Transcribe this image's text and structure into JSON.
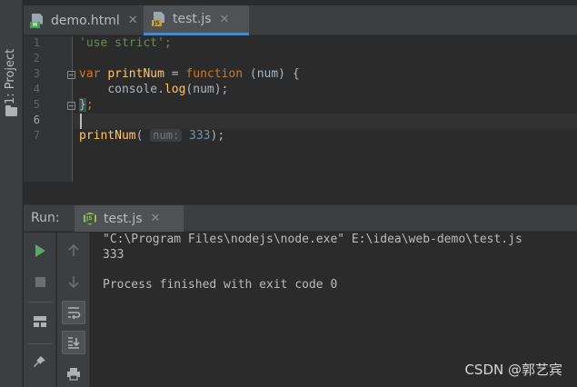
{
  "sidebar": {
    "project_label": "1: Project"
  },
  "tabs": [
    {
      "label": "demo.html",
      "badge": "H",
      "icon": "html-file-icon",
      "close": "✕"
    },
    {
      "label": "test.js",
      "badge": "JS",
      "icon": "js-file-icon",
      "close": "✕"
    }
  ],
  "editor": {
    "line_numbers": [
      "1",
      "2",
      "3",
      "4",
      "5",
      "6",
      "7"
    ],
    "line1": {
      "str": "'use strict';"
    },
    "line3": {
      "kw1": "var",
      "name": "printNum",
      "eq": " = ",
      "kw2": "function",
      "rest": " (num) {"
    },
    "line4": {
      "indent": "    ",
      "obj": "console.",
      "fn": "log",
      "rest": "(num);"
    },
    "line5": {
      "brace": "}",
      "semi": ";"
    },
    "line7": {
      "fn": "printNum",
      "open": "(",
      "hint": "num:",
      "num": "333",
      "close": ");"
    }
  },
  "run": {
    "title": "Run:",
    "tab_label": "test.js",
    "tab_close": "✕",
    "console_lines": [
      "\"C:\\Program Files\\nodejs\\node.exe\" E:\\idea\\web-demo\\test.js",
      "333",
      "",
      "Process finished with exit code 0"
    ]
  },
  "watermark": "CSDN @郭艺宾",
  "colors": {
    "accent": "#4a88c7",
    "keyword": "#cc7832",
    "string": "#6a8759",
    "function": "#ffc66d",
    "number": "#6897bb",
    "run_green": "#59a869"
  }
}
